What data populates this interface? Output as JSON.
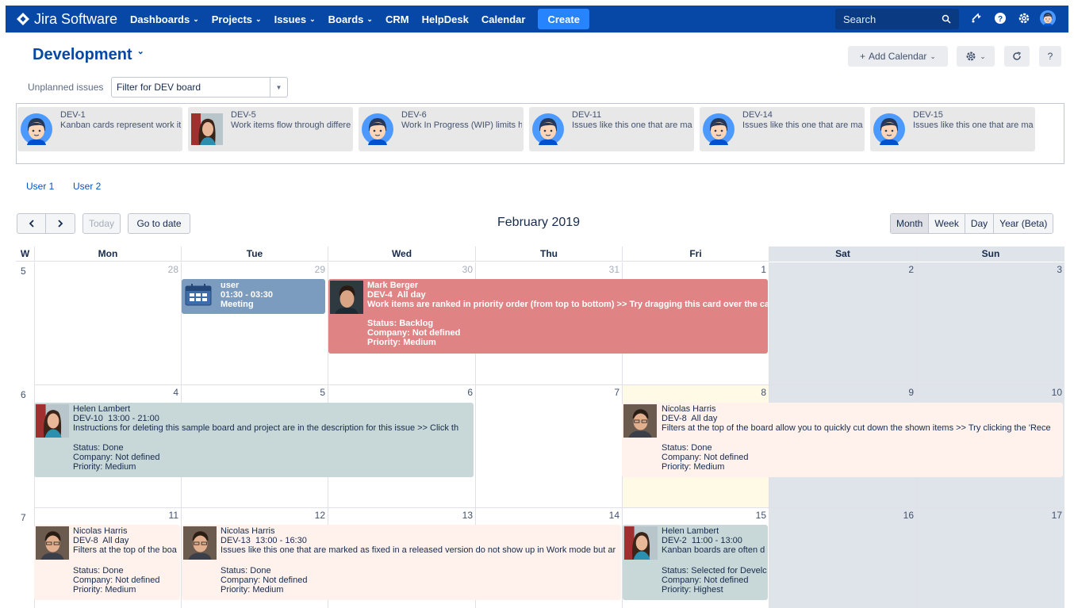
{
  "nav": {
    "app_name": "Jira Software",
    "items": [
      {
        "label": "Dashboards",
        "dropdown": true
      },
      {
        "label": "Projects",
        "dropdown": true
      },
      {
        "label": "Issues",
        "dropdown": true
      },
      {
        "label": "Boards",
        "dropdown": true
      },
      {
        "label": "CRM",
        "dropdown": false
      },
      {
        "label": "HelpDesk",
        "dropdown": false
      },
      {
        "label": "Calendar",
        "dropdown": false
      }
    ],
    "create_label": "Create",
    "search_placeholder": "Search",
    "icons": [
      "search-icon",
      "notifications-icon",
      "help-icon",
      "settings-icon",
      "avatar"
    ]
  },
  "header": {
    "title": "Development",
    "add_calendar_label": "Add Calendar",
    "help_label": "?"
  },
  "unplanned": {
    "label": "Unplanned issues",
    "filter_value": "Filter for DEV board",
    "cards": [
      {
        "key": "DEV-1",
        "summary": "Kanban cards represent work ite",
        "avatar": "default"
      },
      {
        "key": "DEV-5",
        "summary": "Work items flow through differe",
        "avatar": "photo"
      },
      {
        "key": "DEV-6",
        "summary": "Work In Progress (WIP) limits hi",
        "avatar": "default"
      },
      {
        "key": "DEV-11",
        "summary": "Issues like this one that are marl",
        "avatar": "default"
      },
      {
        "key": "DEV-14",
        "summary": "Issues like this one that are marl",
        "avatar": "default"
      },
      {
        "key": "DEV-15",
        "summary": "Issues like this one that are marl",
        "avatar": "default"
      }
    ]
  },
  "users": [
    "User 1",
    "User 2"
  ],
  "toolbar": {
    "today_label": "Today",
    "goto_label": "Go to date",
    "month_title": "February 2019",
    "views": [
      "Month",
      "Week",
      "Day",
      "Year (Beta)"
    ],
    "active_view": "Month"
  },
  "calendar": {
    "week_col": "W",
    "days": [
      "Mon",
      "Tue",
      "Wed",
      "Thu",
      "Fri",
      "Sat",
      "Sun"
    ],
    "weeks": [
      {
        "num": "5",
        "dates": [
          "28",
          "29",
          "30",
          "31",
          "1",
          "2",
          "3"
        ]
      },
      {
        "num": "6",
        "dates": [
          "4",
          "5",
          "6",
          "7",
          "8",
          "9",
          "10"
        ]
      },
      {
        "num": "7",
        "dates": [
          "11",
          "12",
          "13",
          "14",
          "15",
          "16",
          "17"
        ]
      }
    ],
    "events": {
      "meeting": {
        "user": "user",
        "time": "01:30 - 03:30",
        "title": "Meeting"
      },
      "dev4": {
        "name": "Mark Berger",
        "key_time": "DEV-4  All day",
        "summary": "Work items are ranked in priority order (from top to bottom) >> Try dragging this card over the card b",
        "status": "Status: Backlog",
        "company": "Company: Not defined",
        "priority": "Priority: Medium"
      },
      "dev10": {
        "name": "Helen Lambert",
        "key_time": "DEV-10  13:00 - 21:00",
        "summary": "Instructions for deleting this sample board and project are in the description for this issue >> Click th",
        "status": "Status: Done",
        "company": "Company: Not defined",
        "priority": "Priority: Medium"
      },
      "dev8_w6": {
        "name": "Nicolas Harris",
        "key_time": "DEV-8  All day",
        "summary": "Filters at the top of the board allow you to quickly cut down the shown items >> Try clicking the 'Rece",
        "status": "Status: Done",
        "company": "Company: Not defined",
        "priority": "Priority: Medium"
      },
      "dev8_w7": {
        "name": "Nicolas Harris",
        "key_time": "DEV-8  All day",
        "summary": "Filters at the top of the boa",
        "status": "Status: Done",
        "company": "Company: Not defined",
        "priority": "Priority: Medium"
      },
      "dev13": {
        "name": "Nicolas Harris",
        "key_time": "DEV-13  13:00 - 16:30",
        "summary": "Issues like this one that are marked as fixed in a released version do not show up in Work mode but ar",
        "status": "Status: Done",
        "company": "Company: Not defined",
        "priority": "Priority: Medium"
      },
      "dev2": {
        "name": "Helen Lambert",
        "key_time": "DEV-2  11:00 - 13:00",
        "summary": "Kanban boards are often d",
        "status": "Status: Selected for Develc",
        "company": "Company: Not defined",
        "priority": "Priority: Highest"
      }
    }
  }
}
